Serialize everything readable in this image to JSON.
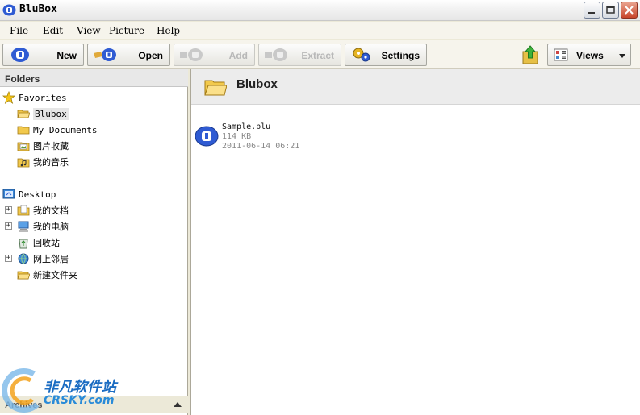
{
  "window": {
    "title": "BluBox"
  },
  "menu": [
    "File",
    "Edit",
    "View",
    "Picture",
    "Help"
  ],
  "toolbar": {
    "new_label": "New",
    "open_label": "Open",
    "add_label": "Add",
    "extract_label": "Extract",
    "settings_label": "Settings",
    "views_label": "Views"
  },
  "folders_pane": {
    "header": "Folders",
    "favorites": {
      "label": "Favorites",
      "items": [
        "Blubox",
        "My Documents",
        "图片收藏",
        "我的音乐"
      ],
      "selected": "Blubox"
    },
    "desktop": {
      "label": "Desktop",
      "items": [
        "我的文档",
        "我的电脑",
        "回收站",
        "网上邻居",
        "新建文件夹"
      ]
    },
    "archives_label": "Archives"
  },
  "content": {
    "folder_title": "Blubox",
    "files": [
      {
        "name": "Sample.blu",
        "size": "114 KB",
        "date": "2011-06-14 06:21"
      }
    ]
  },
  "watermark": {
    "cn": "非凡软件站",
    "en": "CRSKY.com"
  },
  "colors": {
    "accent_blue": "#2f5bd3",
    "folder_yellow": "#f2c94c",
    "watermark_blue": "#1b6cc2"
  }
}
